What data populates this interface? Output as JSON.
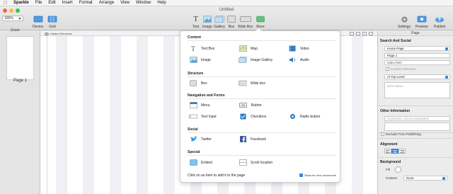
{
  "menubar": {
    "app": "Sparkle",
    "items": [
      "File",
      "Edit",
      "Insert",
      "Format",
      "Arrange",
      "View",
      "Window",
      "Help"
    ]
  },
  "toolbar": {
    "doc_title": "Untitled",
    "zoom_value": "100%",
    "zoom_label": "Zoom",
    "left_items": [
      {
        "label": "Device",
        "icon": "device-icon"
      },
      {
        "label": "Grid",
        "icon": "grid-icon"
      }
    ],
    "center_items": [
      {
        "label": "Text",
        "icon": "text-icon"
      },
      {
        "label": "Image",
        "icon": "image-icon"
      },
      {
        "label": "Gallery",
        "icon": "gallery-icon"
      },
      {
        "label": "Box",
        "icon": "box-icon"
      },
      {
        "label": "Wide Box",
        "icon": "wide-box-icon"
      },
      {
        "label": "More",
        "icon": "more-icon"
      }
    ],
    "right_items": [
      {
        "label": "Settings",
        "icon": "gear-icon"
      },
      {
        "label": "Preview",
        "icon": "eye-icon"
      },
      {
        "label": "Publish",
        "icon": "cloud-upload-icon"
      }
    ]
  },
  "pages_panel": {
    "page_label": "Page 1"
  },
  "canvas": {
    "hidden_elements_label": "Hidden Elements"
  },
  "popover": {
    "sections": {
      "content": "Content",
      "structure": "Structure",
      "navigation": "Navigation and Forms",
      "social": "Social",
      "special": "Special"
    },
    "items": {
      "text_box": "Text Box",
      "map": "Map",
      "video": "Video",
      "image": "Image",
      "image_gallery": "Image Gallery",
      "audio": "Audio",
      "box": "Box",
      "wide_box": "Wide box",
      "menu": "Menu",
      "button": "Button",
      "button_icon_text": "OK",
      "text_input": "Text Input",
      "checkbox": "Checkbox",
      "radio_button": "Radio button",
      "twitter": "Twitter",
      "facebook": "Facebook",
      "embed": "Embed",
      "scroll_location": "Scroll location"
    },
    "footer_hint": "Click on an item to add it to the page",
    "show_for_new_label": "Show for new documents",
    "show_for_new_checked": true
  },
  "inspector": {
    "header": "Page",
    "search_social_title": "Search And Social",
    "page_type": "Home Page",
    "page_name": "Page 1",
    "filename": "index.html",
    "custom_filename_label": "Custom Filename",
    "level": "At Top Level",
    "description_placeholder": "Description",
    "other_info_title": "Other Information",
    "keywords_placeholder": "Keywords, comma separated",
    "exclude_label": "Exclude From Publishing",
    "alignment_title": "Alignment",
    "background_title": "Background",
    "fill_label": "Fill",
    "content_label": "Content",
    "content_value": "None"
  },
  "colors": {
    "accent": "#3b82e0",
    "traffic_red": "#fc5f57",
    "traffic_yellow": "#fdbc2e",
    "traffic_green": "#28c840"
  }
}
